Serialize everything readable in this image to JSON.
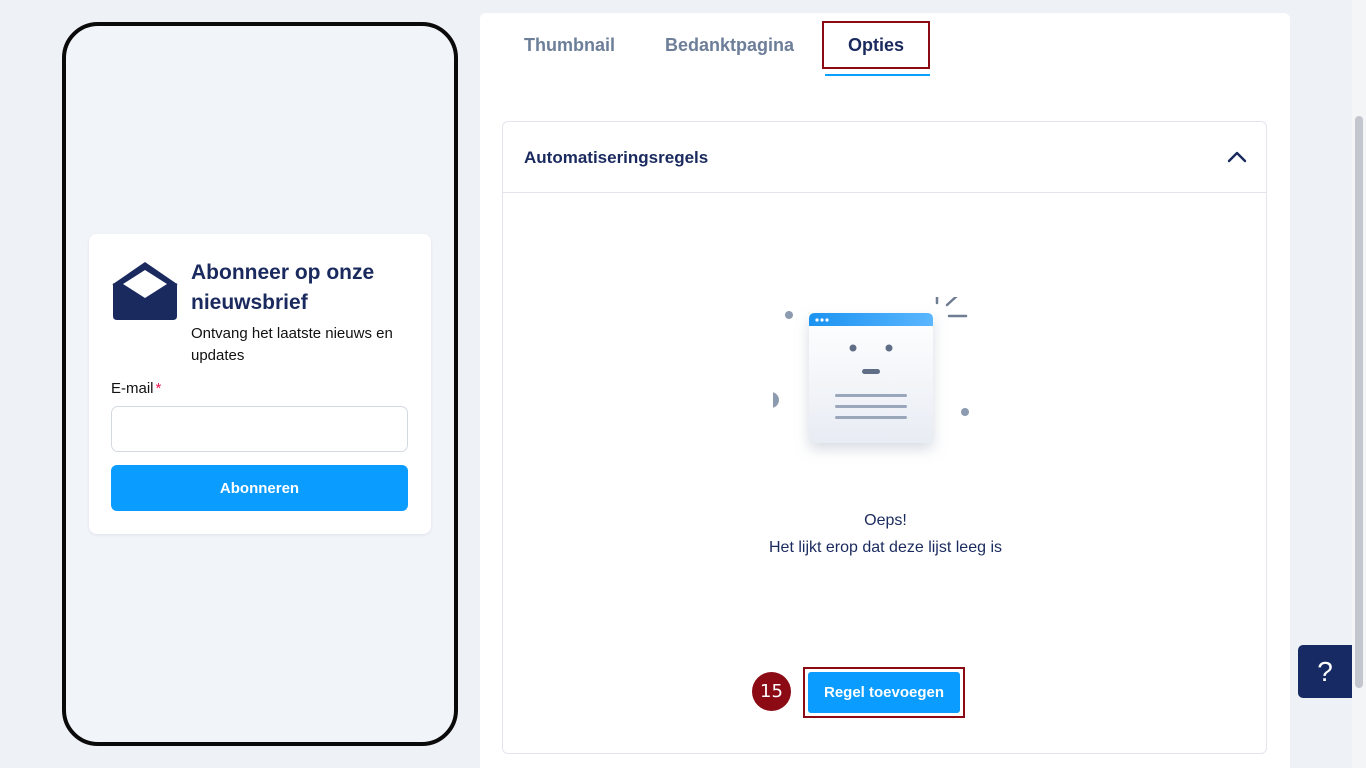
{
  "preview": {
    "newsletter": {
      "title": "Abonneer op onze nieuwsbrief",
      "subtitle": "Ontvang het laatste nieuws en updates",
      "email_label": "E-mail",
      "required_mark": "*",
      "email_value": "",
      "submit_label": "Abonneren",
      "icon": "envelope-open-icon"
    }
  },
  "tabs": [
    {
      "label": "Thumbnail",
      "active": false
    },
    {
      "label": "Bedanktpagina",
      "active": false
    },
    {
      "label": "Opties",
      "active": true
    }
  ],
  "rules": {
    "title": "Automatiseringsregels",
    "collapse_icon": "chevron-up-icon",
    "empty_title": "Oeps!",
    "empty_description": "Het lijkt erop dat deze lijst leeg is",
    "add_label": "Regel toevoegen"
  },
  "annotation": {
    "step": "15"
  },
  "help": {
    "label": "?"
  },
  "colors": {
    "accent": "#0a9cff",
    "navy": "#1a2a5e",
    "highlight": "#8b0a13",
    "help_bg": "#172a63"
  }
}
